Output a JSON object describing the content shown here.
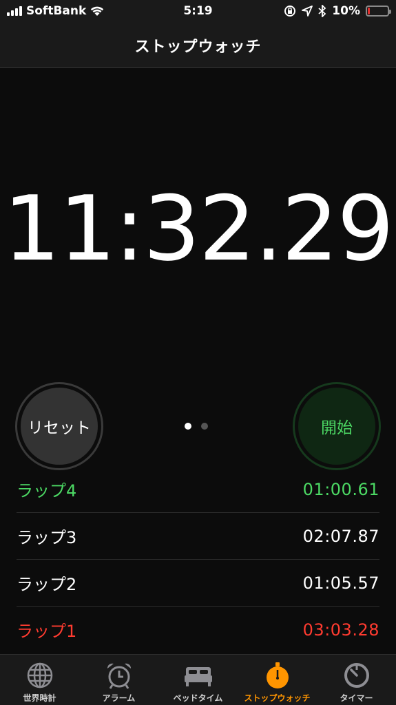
{
  "status_bar": {
    "carrier": "SoftBank",
    "time": "5:19",
    "battery": "10%",
    "battery_level": 0.1
  },
  "nav": {
    "title": "ストップウォッチ"
  },
  "timer": {
    "display": "11:32.29"
  },
  "buttons": {
    "reset_label": "リセット",
    "start_label": "開始"
  },
  "page_indicator": {
    "pages": 2,
    "current": 1
  },
  "laps": [
    {
      "label": "ラップ4",
      "time": "01:00.61",
      "style": "best"
    },
    {
      "label": "ラップ3",
      "time": "02:07.87",
      "style": "normal"
    },
    {
      "label": "ラップ2",
      "time": "01:05.57",
      "style": "normal"
    },
    {
      "label": "ラップ1",
      "time": "03:03.28",
      "style": "worst"
    }
  ],
  "tabs": [
    {
      "label": "世界時計",
      "icon": "globe-icon",
      "active": false
    },
    {
      "label": "アラーム",
      "icon": "alarm-clock-icon",
      "active": false
    },
    {
      "label": "ベッドタイム",
      "icon": "bed-icon",
      "active": false
    },
    {
      "label": "ストップウォッチ",
      "icon": "stopwatch-icon",
      "active": true
    },
    {
      "label": "タイマー",
      "icon": "timer-icon",
      "active": false
    }
  ],
  "colors": {
    "best": "#4cd964",
    "worst": "#ff3b30",
    "normal": "#ffffff",
    "accent": "#ff9500",
    "inactive": "#8e8e93"
  }
}
